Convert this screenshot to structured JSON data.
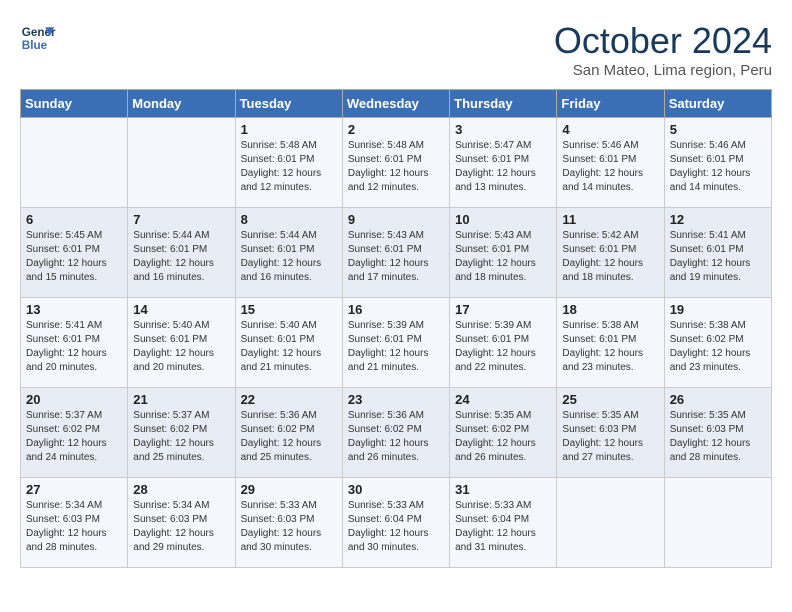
{
  "header": {
    "logo_line1": "General",
    "logo_line2": "Blue",
    "month": "October 2024",
    "location": "San Mateo, Lima region, Peru"
  },
  "weekdays": [
    "Sunday",
    "Monday",
    "Tuesday",
    "Wednesday",
    "Thursday",
    "Friday",
    "Saturday"
  ],
  "weeks": [
    [
      {
        "day": "",
        "info": ""
      },
      {
        "day": "",
        "info": ""
      },
      {
        "day": "1",
        "info": "Sunrise: 5:48 AM\nSunset: 6:01 PM\nDaylight: 12 hours\nand 12 minutes."
      },
      {
        "day": "2",
        "info": "Sunrise: 5:48 AM\nSunset: 6:01 PM\nDaylight: 12 hours\nand 12 minutes."
      },
      {
        "day": "3",
        "info": "Sunrise: 5:47 AM\nSunset: 6:01 PM\nDaylight: 12 hours\nand 13 minutes."
      },
      {
        "day": "4",
        "info": "Sunrise: 5:46 AM\nSunset: 6:01 PM\nDaylight: 12 hours\nand 14 minutes."
      },
      {
        "day": "5",
        "info": "Sunrise: 5:46 AM\nSunset: 6:01 PM\nDaylight: 12 hours\nand 14 minutes."
      }
    ],
    [
      {
        "day": "6",
        "info": "Sunrise: 5:45 AM\nSunset: 6:01 PM\nDaylight: 12 hours\nand 15 minutes."
      },
      {
        "day": "7",
        "info": "Sunrise: 5:44 AM\nSunset: 6:01 PM\nDaylight: 12 hours\nand 16 minutes."
      },
      {
        "day": "8",
        "info": "Sunrise: 5:44 AM\nSunset: 6:01 PM\nDaylight: 12 hours\nand 16 minutes."
      },
      {
        "day": "9",
        "info": "Sunrise: 5:43 AM\nSunset: 6:01 PM\nDaylight: 12 hours\nand 17 minutes."
      },
      {
        "day": "10",
        "info": "Sunrise: 5:43 AM\nSunset: 6:01 PM\nDaylight: 12 hours\nand 18 minutes."
      },
      {
        "day": "11",
        "info": "Sunrise: 5:42 AM\nSunset: 6:01 PM\nDaylight: 12 hours\nand 18 minutes."
      },
      {
        "day": "12",
        "info": "Sunrise: 5:41 AM\nSunset: 6:01 PM\nDaylight: 12 hours\nand 19 minutes."
      }
    ],
    [
      {
        "day": "13",
        "info": "Sunrise: 5:41 AM\nSunset: 6:01 PM\nDaylight: 12 hours\nand 20 minutes."
      },
      {
        "day": "14",
        "info": "Sunrise: 5:40 AM\nSunset: 6:01 PM\nDaylight: 12 hours\nand 20 minutes."
      },
      {
        "day": "15",
        "info": "Sunrise: 5:40 AM\nSunset: 6:01 PM\nDaylight: 12 hours\nand 21 minutes."
      },
      {
        "day": "16",
        "info": "Sunrise: 5:39 AM\nSunset: 6:01 PM\nDaylight: 12 hours\nand 21 minutes."
      },
      {
        "day": "17",
        "info": "Sunrise: 5:39 AM\nSunset: 6:01 PM\nDaylight: 12 hours\nand 22 minutes."
      },
      {
        "day": "18",
        "info": "Sunrise: 5:38 AM\nSunset: 6:01 PM\nDaylight: 12 hours\nand 23 minutes."
      },
      {
        "day": "19",
        "info": "Sunrise: 5:38 AM\nSunset: 6:02 PM\nDaylight: 12 hours\nand 23 minutes."
      }
    ],
    [
      {
        "day": "20",
        "info": "Sunrise: 5:37 AM\nSunset: 6:02 PM\nDaylight: 12 hours\nand 24 minutes."
      },
      {
        "day": "21",
        "info": "Sunrise: 5:37 AM\nSunset: 6:02 PM\nDaylight: 12 hours\nand 25 minutes."
      },
      {
        "day": "22",
        "info": "Sunrise: 5:36 AM\nSunset: 6:02 PM\nDaylight: 12 hours\nand 25 minutes."
      },
      {
        "day": "23",
        "info": "Sunrise: 5:36 AM\nSunset: 6:02 PM\nDaylight: 12 hours\nand 26 minutes."
      },
      {
        "day": "24",
        "info": "Sunrise: 5:35 AM\nSunset: 6:02 PM\nDaylight: 12 hours\nand 26 minutes."
      },
      {
        "day": "25",
        "info": "Sunrise: 5:35 AM\nSunset: 6:03 PM\nDaylight: 12 hours\nand 27 minutes."
      },
      {
        "day": "26",
        "info": "Sunrise: 5:35 AM\nSunset: 6:03 PM\nDaylight: 12 hours\nand 28 minutes."
      }
    ],
    [
      {
        "day": "27",
        "info": "Sunrise: 5:34 AM\nSunset: 6:03 PM\nDaylight: 12 hours\nand 28 minutes."
      },
      {
        "day": "28",
        "info": "Sunrise: 5:34 AM\nSunset: 6:03 PM\nDaylight: 12 hours\nand 29 minutes."
      },
      {
        "day": "29",
        "info": "Sunrise: 5:33 AM\nSunset: 6:03 PM\nDaylight: 12 hours\nand 30 minutes."
      },
      {
        "day": "30",
        "info": "Sunrise: 5:33 AM\nSunset: 6:04 PM\nDaylight: 12 hours\nand 30 minutes."
      },
      {
        "day": "31",
        "info": "Sunrise: 5:33 AM\nSunset: 6:04 PM\nDaylight: 12 hours\nand 31 minutes."
      },
      {
        "day": "",
        "info": ""
      },
      {
        "day": "",
        "info": ""
      }
    ]
  ]
}
